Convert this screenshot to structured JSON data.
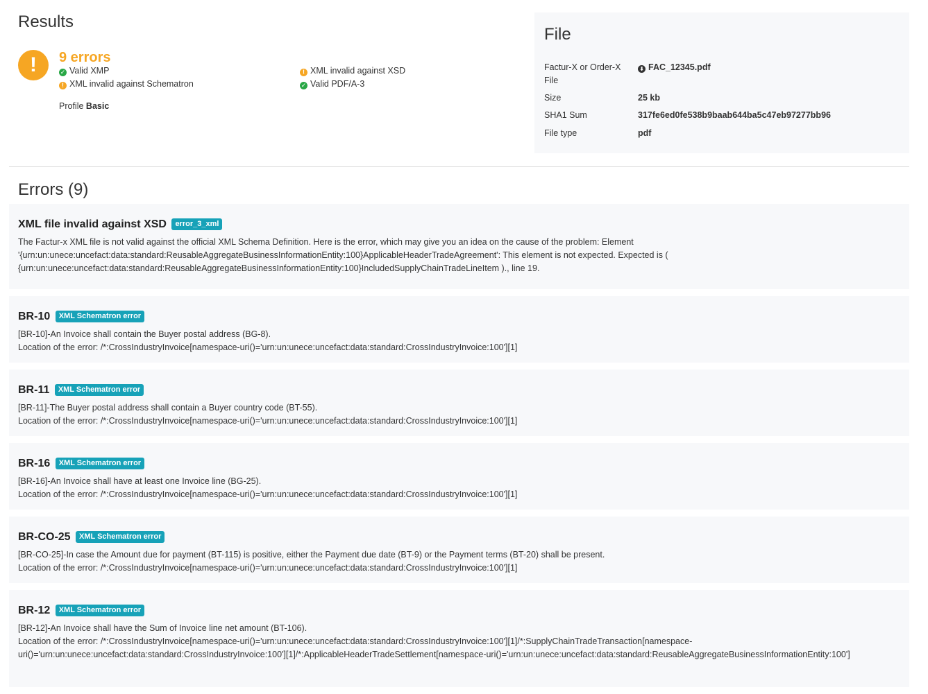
{
  "results": {
    "title": "Results",
    "errors_summary": "9 errors",
    "checks": [
      {
        "label": "Valid XMP",
        "status": "ok"
      },
      {
        "label": "XML invalid against XSD",
        "status": "warn"
      },
      {
        "label": "XML invalid against Schematron",
        "status": "warn"
      },
      {
        "label": "Valid PDF/A-3",
        "status": "ok"
      }
    ],
    "profile_label": "Profile",
    "profile_value": "Basic",
    "status_icon": "!"
  },
  "file": {
    "title": "File",
    "rows": [
      {
        "key": "Factur-X or Order-X File",
        "value": "FAC_12345.pdf",
        "icon": "download-icon"
      },
      {
        "key": "Size",
        "value": "25 kb"
      },
      {
        "key": "SHA1 Sum",
        "value": "317fe6ed0fe538b9baab644ba5c47eb97277bb96"
      },
      {
        "key": "File type",
        "value": "pdf"
      }
    ]
  },
  "errors": {
    "title": "Errors (9)",
    "items": [
      {
        "code": "XML file invalid against XSD",
        "badge": "error_3_xml",
        "lines": [
          "The Factur-x XML file is not valid against the official XML Schema Definition. Here is the error, which may give you an idea on the cause of the problem: Element '{urn:un:unece:uncefact:data:standard:ReusableAggregateBusinessInformationEntity:100}ApplicableHeaderTradeAgreement': This element is not expected. Expected is ( {urn:un:unece:uncefact:data:standard:ReusableAggregateBusinessInformationEntity:100}IncludedSupplyChainTradeLineItem )., line 19."
        ]
      },
      {
        "code": "BR-10",
        "badge": "XML Schematron error",
        "lines": [
          "[BR-10]-An Invoice shall contain the Buyer postal address (BG-8).",
          "Location of the error: /*:CrossIndustryInvoice[namespace-uri()='urn:un:unece:uncefact:data:standard:CrossIndustryInvoice:100'][1]"
        ]
      },
      {
        "code": "BR-11",
        "badge": "XML Schematron error",
        "lines": [
          "[BR-11]-The Buyer postal address shall contain a Buyer country code (BT-55).",
          "Location of the error: /*:CrossIndustryInvoice[namespace-uri()='urn:un:unece:uncefact:data:standard:CrossIndustryInvoice:100'][1]"
        ]
      },
      {
        "code": "BR-16",
        "badge": "XML Schematron error",
        "lines": [
          "[BR-16]-An Invoice shall have at least one Invoice line (BG-25).",
          "Location of the error: /*:CrossIndustryInvoice[namespace-uri()='urn:un:unece:uncefact:data:standard:CrossIndustryInvoice:100'][1]"
        ]
      },
      {
        "code": "BR-CO-25",
        "badge": "XML Schematron error",
        "lines": [
          "[BR-CO-25]-In case the Amount due for payment (BT-115) is positive, either the Payment due date (BT-9) or the Payment terms (BT-20) shall be present.",
          "Location of the error: /*:CrossIndustryInvoice[namespace-uri()='urn:un:unece:uncefact:data:standard:CrossIndustryInvoice:100'][1]"
        ]
      },
      {
        "code": "BR-12",
        "badge": "XML Schematron error",
        "lines": [
          "[BR-12]-An Invoice shall have the Sum of Invoice line net amount (BT-106).",
          "Location of the error: /*:CrossIndustryInvoice[namespace-uri()='urn:un:unece:uncefact:data:standard:CrossIndustryInvoice:100'][1]/*:SupplyChainTradeTransaction[namespace-uri()='urn:un:unece:uncefact:data:standard:CrossIndustryInvoice:100'][1]/*:ApplicableHeaderTradeSettlement[namespace-uri()='urn:un:unece:uncefact:data:standard:ReusableAggregateBusinessInformationEntity:100']"
        ]
      }
    ]
  }
}
